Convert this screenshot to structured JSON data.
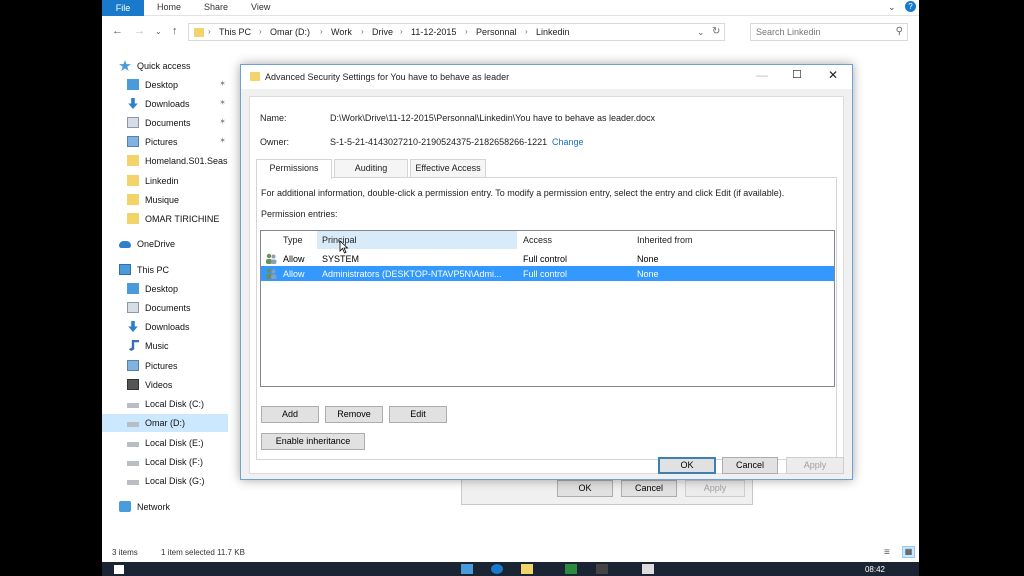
{
  "explorer": {
    "ribbon": {
      "file": "File",
      "home": "Home",
      "share": "Share",
      "view": "View"
    },
    "breadcrumb": [
      "This PC",
      "Omar (D:)",
      "Work",
      "Drive",
      "11-12-2015",
      "Personnal",
      "Linkedin"
    ],
    "search_placeholder": "Search Linkedin",
    "sidebar": [
      {
        "label": "Quick access",
        "icon": "star-icon"
      },
      {
        "label": "Desktop",
        "icon": "desktop-icon",
        "pinned": true
      },
      {
        "label": "Downloads",
        "icon": "download-icon",
        "pinned": true
      },
      {
        "label": "Documents",
        "icon": "documents-icon",
        "pinned": true
      },
      {
        "label": "Pictures",
        "icon": "pictures-icon",
        "pinned": true
      },
      {
        "label": "Homeland.S01.Seas",
        "icon": "folder-icon"
      },
      {
        "label": "Linkedin",
        "icon": "folder-icon"
      },
      {
        "label": "Musique",
        "icon": "folder-icon"
      },
      {
        "label": "OMAR TIRICHINE",
        "icon": "folder-icon"
      },
      {
        "label": "OneDrive",
        "icon": "cloud-icon"
      },
      {
        "label": "This PC",
        "icon": "computer-icon"
      },
      {
        "label": "Desktop",
        "icon": "desktop-icon"
      },
      {
        "label": "Documents",
        "icon": "documents-icon"
      },
      {
        "label": "Downloads",
        "icon": "download-icon"
      },
      {
        "label": "Music",
        "icon": "music-icon"
      },
      {
        "label": "Pictures",
        "icon": "pictures-icon"
      },
      {
        "label": "Videos",
        "icon": "videos-icon"
      },
      {
        "label": "Local Disk (C:)",
        "icon": "drive-icon"
      },
      {
        "label": "Omar (D:)",
        "icon": "drive-icon",
        "selected": true
      },
      {
        "label": "Local Disk (E:)",
        "icon": "drive-icon"
      },
      {
        "label": "Local Disk (F:)",
        "icon": "drive-icon"
      },
      {
        "label": "Local Disk (G:)",
        "icon": "drive-icon"
      },
      {
        "label": "Network",
        "icon": "network-icon"
      }
    ],
    "status": {
      "items": "3 items",
      "selected": "1 item selected  11.7 KB"
    },
    "clock": "08:42",
    "bg_buttons": {
      "ok": "OK",
      "cancel": "Cancel",
      "apply": "Apply"
    }
  },
  "dialog": {
    "title": "Advanced Security Settings for You have to behave as leader",
    "name_label": "Name:",
    "name_value": "D:\\Work\\Drive\\11-12-2015\\Personnal\\Linkedin\\You have to behave as leader.docx",
    "owner_label": "Owner:",
    "owner_value": "S-1-5-21-4143027210-2190524375-2182658266-1221",
    "change_link": "Change",
    "tabs": [
      "Permissions",
      "Auditing",
      "Effective Access"
    ],
    "info": "For additional information, double-click a permission entry. To modify a permission entry, select the entry and click Edit (if available).",
    "entries_label": "Permission entries:",
    "columns": [
      "Type",
      "Principal",
      "Access",
      "Inherited from"
    ],
    "rows": [
      {
        "type": "Allow",
        "principal": "SYSTEM",
        "access": "Full control",
        "inherited": "None",
        "selected": false
      },
      {
        "type": "Allow",
        "principal": "Administrators (DESKTOP-NTAVP5N\\Admi...",
        "access": "Full control",
        "inherited": "None",
        "selected": true
      }
    ],
    "buttons": {
      "add": "Add",
      "remove": "Remove",
      "edit": "Edit",
      "enable_inheritance": "Enable inheritance",
      "ok": "OK",
      "cancel": "Cancel",
      "apply": "Apply"
    }
  }
}
